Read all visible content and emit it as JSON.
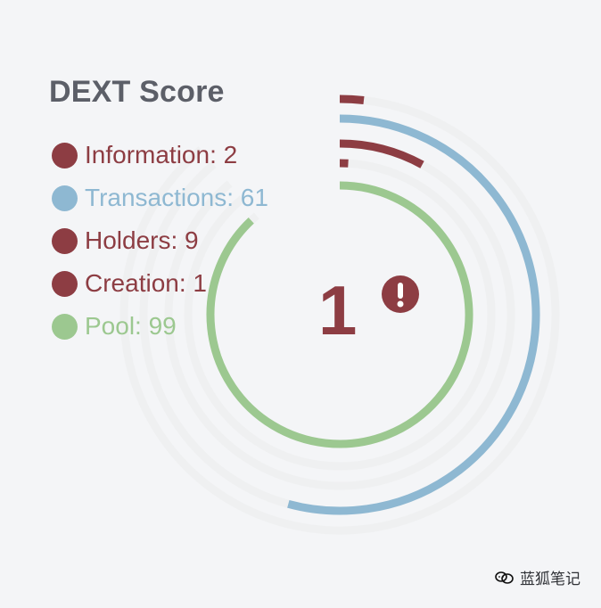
{
  "title": "DEXT Score",
  "score": "1",
  "alert_icon": "exclamation-circle-icon",
  "watermark_text": "蓝狐笔记",
  "watermark_icon": "chat-bubbles-icon",
  "colors": {
    "red": "#8d3d43",
    "blue": "#8eb8d2",
    "green": "#9cc890",
    "track": "#eceeee",
    "title": "#5c5f68"
  },
  "legend": [
    {
      "label": "Information: 2",
      "color": "#8d3d43",
      "text_color": "#8d3d43"
    },
    {
      "label": "Transactions: 61",
      "color": "#8eb8d2",
      "text_color": "#8eb8d2"
    },
    {
      "label": "Holders: 9",
      "color": "#8d3d43",
      "text_color": "#8d3d43"
    },
    {
      "label": "Creation: 1",
      "color": "#8d3d43",
      "text_color": "#8d3d43"
    },
    {
      "label": "Pool: 99",
      "color": "#9cc890",
      "text_color": "#9cc890"
    }
  ],
  "chart_data": {
    "type": "radial-bar",
    "title": "DEXT Score",
    "categories": [
      "Information",
      "Transactions",
      "Holders",
      "Creation",
      "Pool"
    ],
    "values": [
      2,
      61,
      9,
      1,
      99
    ],
    "colors": [
      "#8d3d43",
      "#8eb8d2",
      "#8d3d43",
      "#8d3d43",
      "#9cc890"
    ],
    "center_score": 1,
    "ylim": [
      0,
      100
    ]
  }
}
